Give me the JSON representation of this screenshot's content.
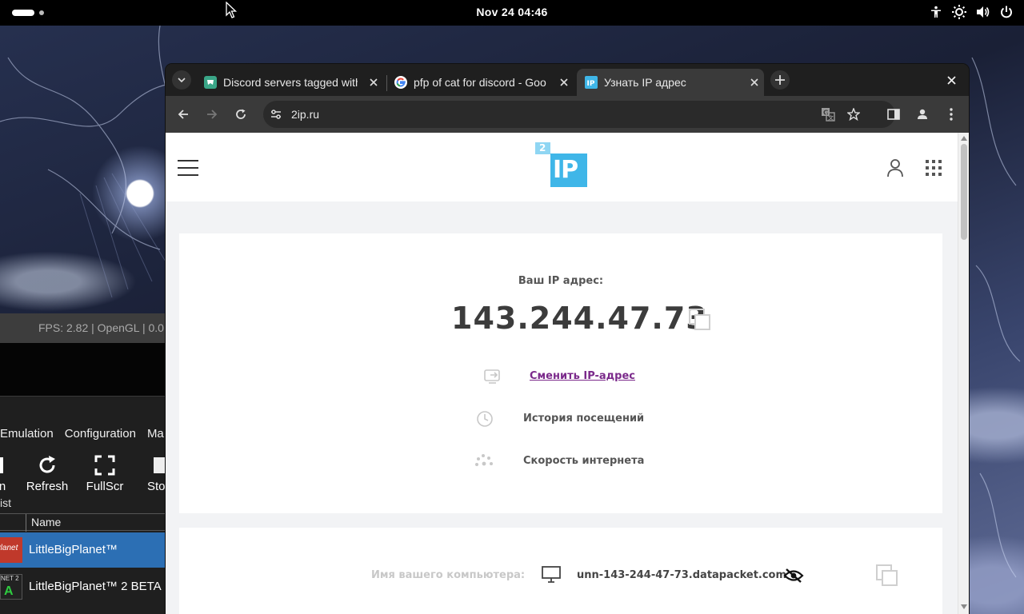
{
  "topbar": {
    "clock": "Nov 24  04:46"
  },
  "emulator": {
    "fps_text": "FPS: 2.82 | OpenGL | 0.0",
    "menu": [
      "Emulation",
      "Configuration",
      "Ma"
    ],
    "tools": [
      {
        "label": "n",
        "icon": "open-icon"
      },
      {
        "label": "Refresh",
        "icon": "refresh-icon"
      },
      {
        "label": "FullScr",
        "icon": "fullscreen-icon"
      },
      {
        "label": "Sto",
        "icon": "stop-icon"
      }
    ],
    "list_title": "ist",
    "column_name": "Name",
    "games": [
      {
        "name": "LittleBigPlanet™",
        "thumb_text": "Planet",
        "selected": true
      },
      {
        "name": "LittleBigPlanet™ 2 BETA",
        "thumb_text": "NET 2",
        "selected": false
      }
    ]
  },
  "browser": {
    "tabs": [
      {
        "title": "Discord servers tagged with",
        "favicon": "discord-servers-favicon",
        "active": false
      },
      {
        "title": "pfp of cat for discord - Goo",
        "favicon": "google-favicon",
        "active": false
      },
      {
        "title": "Узнать IP адрес",
        "favicon": "2ip-favicon",
        "active": true
      }
    ],
    "url": "2ip.ru"
  },
  "site": {
    "logo_small": "2",
    "logo_big": "IP",
    "ip_label": "Ваш IP адрес:",
    "ip_value": "143.244.47.73",
    "links": [
      {
        "text": "Сменить IP-адрес",
        "icon": "change-ip-icon",
        "is_link": true
      },
      {
        "text": "История посещений",
        "icon": "history-icon",
        "is_link": false
      },
      {
        "text": "Скорость интернета",
        "icon": "speed-icon",
        "is_link": false
      }
    ],
    "host_label": "Имя вашего компьютера:",
    "host_value": "unn-143-244-47-73.datapacket.com"
  },
  "colors": {
    "accent": "#3fb6e8",
    "link": "#7b2a8b",
    "selection": "#2c6fb4"
  }
}
